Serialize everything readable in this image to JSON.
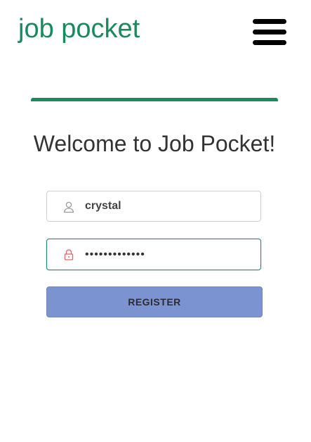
{
  "header": {
    "brand": "job pocket",
    "menu_icon": "hamburger-menu-icon"
  },
  "colors": {
    "brand": "#1a8a5e",
    "button": "#7b93d0",
    "focus_border": "#1a8a7a",
    "lock_icon": "#e06666"
  },
  "form": {
    "title": "Welcome to Job Pocket!",
    "username": {
      "icon": "user-icon",
      "value": "crystal"
    },
    "password": {
      "icon": "lock-icon",
      "value": "•••••••••••••"
    },
    "register_label": "REGISTER"
  }
}
